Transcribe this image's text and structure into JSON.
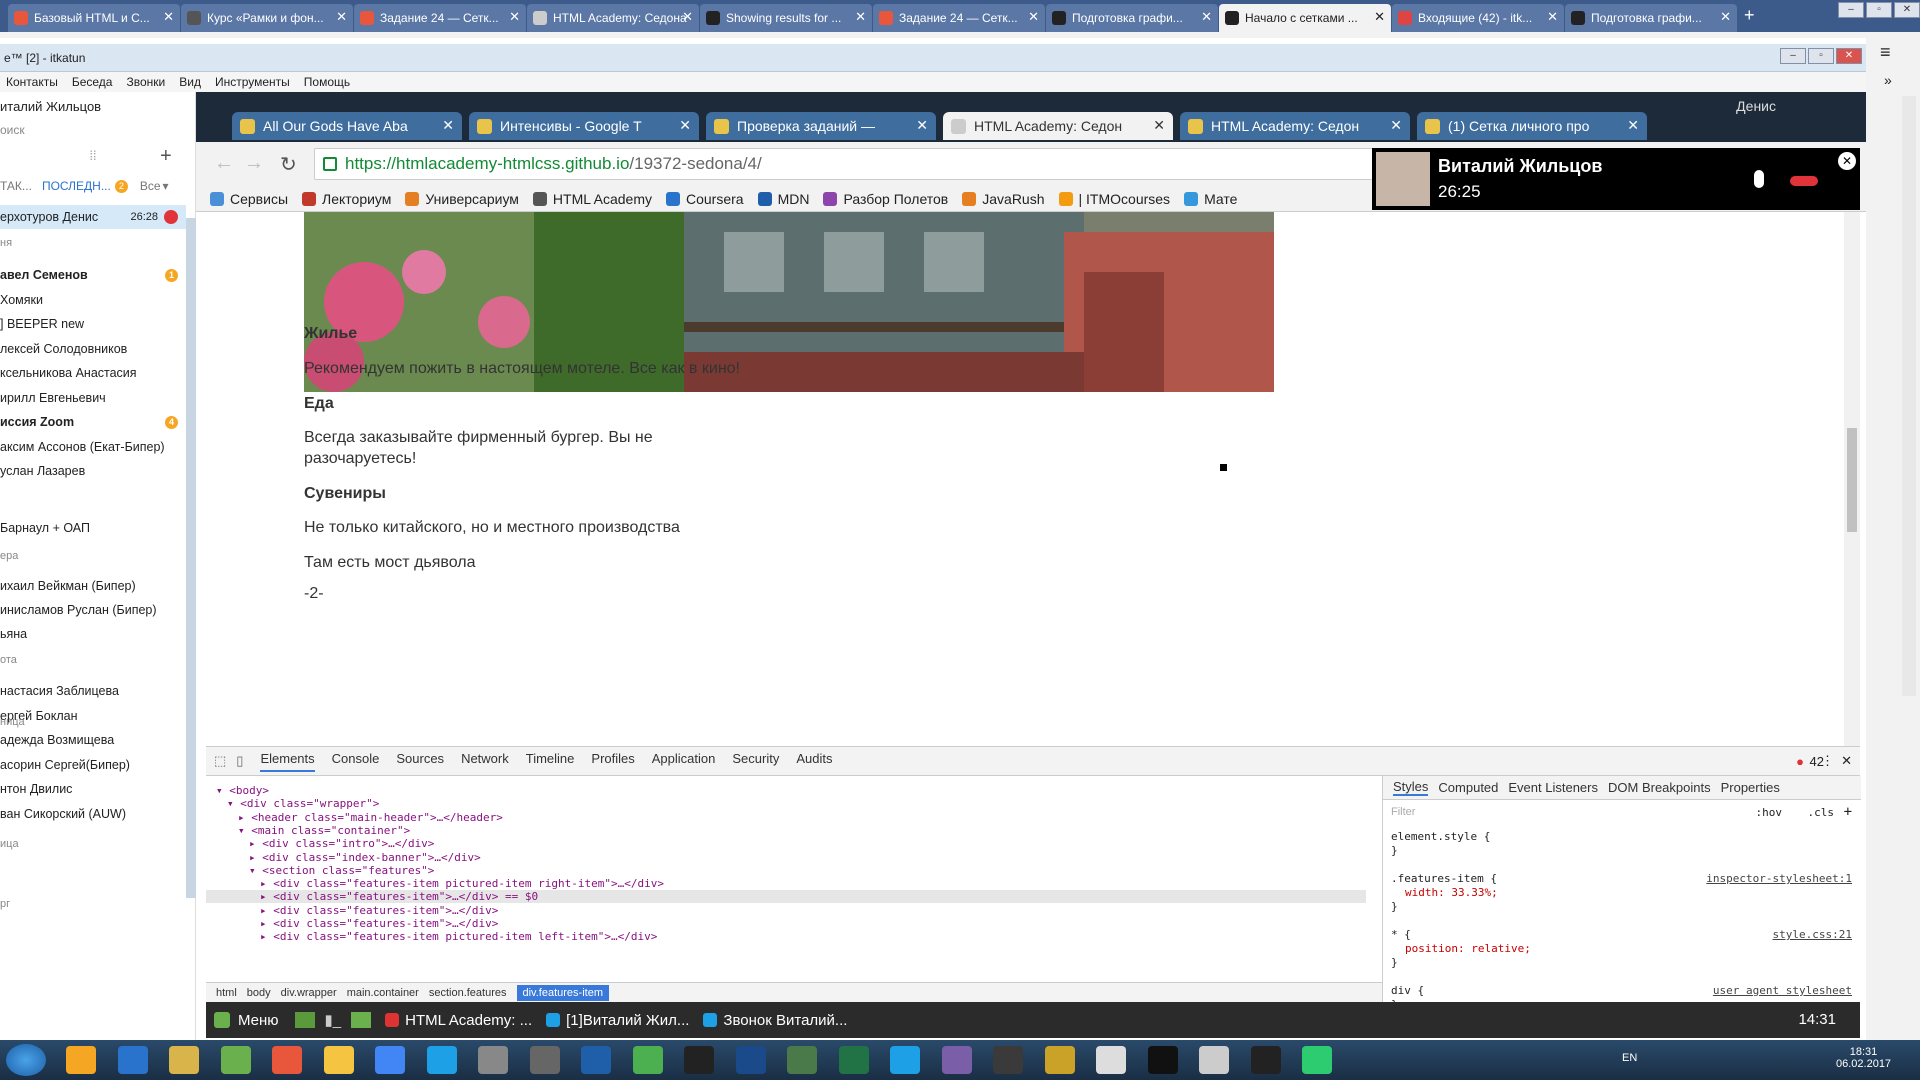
{
  "outer_browser": {
    "tabs": [
      {
        "label": "Базовый HTML и С...",
        "icon": "bookmark-icon",
        "color": "#e8573c"
      },
      {
        "label": "Курс «Рамки и фон...",
        "icon": "shield-icon",
        "color": "#555"
      },
      {
        "label": "Задание 24 — Сетк...",
        "icon": "academy-icon",
        "color": "#e8573c"
      },
      {
        "label": "HTML Academy: Седона",
        "icon": "page-icon",
        "color": "#ccc"
      },
      {
        "label": "Showing results for ...",
        "icon": "scholar-icon",
        "color": "#222"
      },
      {
        "label": "Задание 24 — Сетк...",
        "icon": "academy-icon",
        "color": "#e8573c"
      },
      {
        "label": "Подготовка графи...",
        "icon": "github-icon",
        "color": "#222"
      },
      {
        "label": "Начало с сетками ...",
        "icon": "github-icon",
        "color": "#222",
        "active": true
      },
      {
        "label": "Входящие (42) - itk...",
        "icon": "gmail-icon",
        "color": "#d44"
      },
      {
        "label": "Подготовка графи...",
        "icon": "github-icon",
        "color": "#222"
      }
    ],
    "new_tab": "+"
  },
  "skype": {
    "title": "e™ [2] - itkatun",
    "menu": [
      "Контакты",
      "Беседа",
      "Звонки",
      "Вид",
      "Инструменты",
      "Помощь"
    ],
    "user_name": "италий Жильцов",
    "search_placeholder": "оиск",
    "filter_tabs": {
      "contacts": "ТАК...",
      "recent": "ПОСЛЕДН...",
      "recent_badge": "2",
      "all": "Все"
    },
    "active_call": {
      "name": "ерхотуров Денис",
      "time": "26:28"
    },
    "sections": {
      "today": "ня",
      "yesterday": "ера",
      "week": "ота",
      "month": "ница",
      "older": "ица",
      "last": "рг"
    },
    "contacts": [
      {
        "name": "авел Семенов",
        "bold": true,
        "badge": "1"
      },
      {
        "name": " Хомяки"
      },
      {
        "name": "] BEEPER new"
      },
      {
        "name": "лексей Солодовников"
      },
      {
        "name": "ксельникова Анастасия"
      },
      {
        "name": "ирилл Евгеньевич"
      },
      {
        "name": "иссия Zoom",
        "bold": true,
        "badge": "4"
      },
      {
        "name": "аксим Ассонов (Екат-Бипер)"
      },
      {
        "name": "услан Лазарев"
      },
      {
        "name": ""
      },
      {
        "name": " Барнаул + ОАП"
      },
      {
        "name": "ихаил Вейкман (Бипер)"
      },
      {
        "name": "инисламов Руслан (Бипер)"
      },
      {
        "name": "ьяна"
      },
      {
        "name": "настасия Заблицева"
      },
      {
        "name": "ергей Боклан"
      },
      {
        "name": "адежда Возмищева"
      },
      {
        "name": "асорин Сергей(Бипер)"
      },
      {
        "name": "нтон Двилис"
      },
      {
        "name": "ван Сикорский (AUW)"
      }
    ]
  },
  "inner_browser": {
    "tabs": [
      {
        "label": "All Our Gods Have Aba",
        "icon": "music-icon"
      },
      {
        "label": "Интенсивы - Google T",
        "icon": "sheets-icon"
      },
      {
        "label": "Проверка заданий —",
        "icon": "academy-icon"
      },
      {
        "label": "HTML Academy: Седон",
        "icon": "page-icon",
        "active": true
      },
      {
        "label": "HTML Academy: Седон",
        "icon": "page-icon"
      },
      {
        "label": "(1) Сетка личного про",
        "icon": "github-icon"
      }
    ],
    "profile_label": "Денис",
    "url_host": "https://htmlacademy-htmlcss.github.io",
    "url_path": "/19372-sedona/4/",
    "bookmarks": [
      {
        "label": "Сервисы",
        "color": "#4a90d9"
      },
      {
        "label": "Лекториум",
        "color": "#c0392b"
      },
      {
        "label": "Универсариум",
        "color": "#e67e22"
      },
      {
        "label": "HTML Academy",
        "color": "#555"
      },
      {
        "label": "Coursera",
        "color": "#2a73cc"
      },
      {
        "label": "MDN",
        "color": "#1f5ea8"
      },
      {
        "label": "Разбор Полетов",
        "color": "#8e44ad"
      },
      {
        "label": "JavaRush",
        "color": "#e67e22"
      },
      {
        "label": "| ITMOcourses",
        "color": "#f39c12"
      },
      {
        "label": "Мате",
        "color": "#3498db"
      }
    ]
  },
  "page": {
    "sections": [
      {
        "heading": "Жилье",
        "text": "Рекомендуем пожить в настоящем мотеле. Все как в кино!"
      },
      {
        "heading": "Еда",
        "text": "Всегда заказывайте фирменный бургер. Вы не",
        "text2": "разочаруетесь!"
      },
      {
        "heading": "Сувениры",
        "text": "Не только китайского, но и местного производства"
      }
    ],
    "extra": "Там есть мост дьявола",
    "page_number": "-2-"
  },
  "call_overlay": {
    "name": "Виталий Жильцов",
    "duration": "26:25"
  },
  "devtools": {
    "tabs": [
      "Elements",
      "Console",
      "Sources",
      "Network",
      "Timeline",
      "Profiles",
      "Application",
      "Security",
      "Audits"
    ],
    "error_count": "42",
    "dom_lines": [
      {
        "indent": 0,
        "html": "<body>"
      },
      {
        "indent": 1,
        "tag": "div",
        "cls": "wrapper",
        "open": true
      },
      {
        "indent": 2,
        "tag": "header",
        "cls": "main-header",
        "collapsed": "header"
      },
      {
        "indent": 2,
        "tag": "main",
        "cls": "container",
        "open": true
      },
      {
        "indent": 3,
        "tag": "div",
        "cls": "intro",
        "collapsed": "div"
      },
      {
        "indent": 3,
        "tag": "div",
        "cls": "index-banner",
        "collapsed": "div"
      },
      {
        "indent": 3,
        "tag": "section",
        "cls": "features",
        "open": true
      },
      {
        "indent": 4,
        "tag": "div",
        "cls": "features-item pictured-item right-item",
        "collapsed": "div"
      },
      {
        "indent": 4,
        "tag": "div",
        "cls": "features-item",
        "collapsed": "div",
        "selected": true,
        "suffix": " == $0"
      },
      {
        "indent": 4,
        "tag": "div",
        "cls": "features-item",
        "collapsed": "div"
      },
      {
        "indent": 4,
        "tag": "div",
        "cls": "features-item",
        "collapsed": "div"
      },
      {
        "indent": 4,
        "tag": "div",
        "cls": "features-item  pictured-item left-item",
        "collapsed": "div"
      }
    ],
    "breadcrumb": [
      "html",
      "body",
      "div.wrapper",
      "main.container",
      "section.features",
      "div.features-item"
    ],
    "styles_tabs": [
      "Styles",
      "Computed",
      "Event Listeners",
      "DOM Breakpoints",
      "Properties"
    ],
    "filter_placeholder": "Filter",
    "hov": ":hov",
    "cls": ".cls",
    "rules": [
      {
        "selector": "element.style {",
        "decls": [],
        "source": ""
      },
      {
        "selector": ".features-item {",
        "decls": [
          "width: 33.33%;"
        ],
        "source": "inspector-stylesheet:1"
      },
      {
        "selector": "* {",
        "decls": [
          "position: relative;"
        ],
        "source": "style.css:21"
      },
      {
        "selector": "div {",
        "decls": [],
        "source": "user agent stylesheet"
      }
    ]
  },
  "linux_panel": {
    "menu": "Меню",
    "windows": [
      "HTML Academy: ...",
      "[1]Виталий Жил...",
      "Звонок Виталий..."
    ],
    "clock": "14:31"
  },
  "taskbar": {
    "lang": "EN",
    "time": "18:31",
    "date": "06.02.2017"
  }
}
